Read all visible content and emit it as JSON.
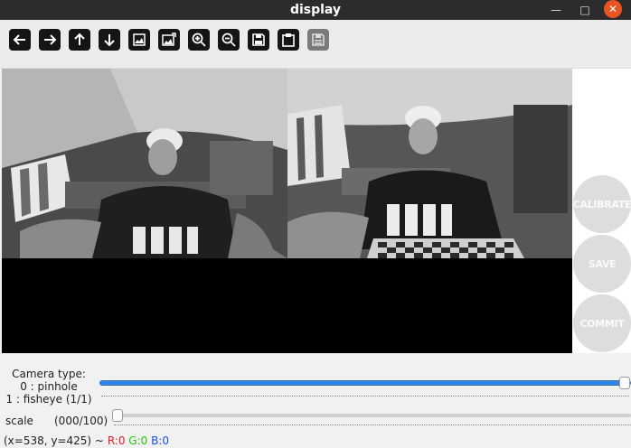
{
  "window": {
    "title": "display"
  },
  "toolbar": {
    "tools": [
      {
        "name": "pan-left-icon"
      },
      {
        "name": "pan-right-icon"
      },
      {
        "name": "pan-up-icon"
      },
      {
        "name": "pan-down-icon"
      },
      {
        "name": "zoom-fit-icon"
      },
      {
        "name": "zoom-original-icon"
      },
      {
        "name": "zoom-in-icon"
      },
      {
        "name": "zoom-out-icon"
      },
      {
        "name": "save-image-icon"
      },
      {
        "name": "copy-clipboard-icon"
      },
      {
        "name": "properties-icon"
      }
    ]
  },
  "side_buttons": {
    "calibrate": "CALIBRATE",
    "save": "SAVE",
    "commit": "COMMIT"
  },
  "trackbars": {
    "camera_type": {
      "line1": "Camera type:",
      "line2": "0 : pinhole",
      "line3": "1 : fisheye (1/1)",
      "value": 1,
      "max": 1
    },
    "scale": {
      "label": "scale",
      "value_text": "(000/100)",
      "value": 0,
      "max": 100
    }
  },
  "status": {
    "coords": "(x=538, y=425) ~",
    "r": "R:0",
    "g": "G:0",
    "b": "B:0"
  }
}
